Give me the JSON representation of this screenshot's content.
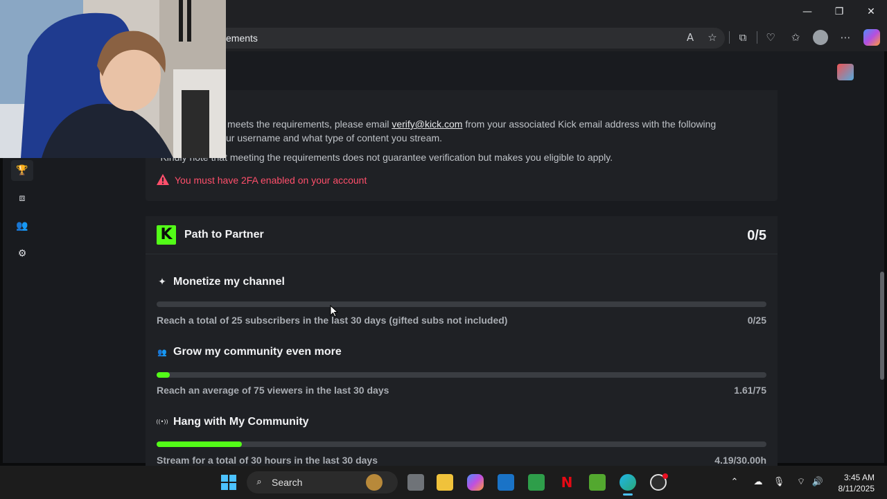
{
  "browser": {
    "address_text": "ements",
    "window_controls": {
      "minimize": "—",
      "restore": "❐",
      "close": "✕"
    },
    "toolbar_icons": [
      "read-aloud-icon",
      "favorite-star-icon",
      "extensions-icon",
      "browser-essentials-icon",
      "favorites-icon",
      "profile-avatar-icon",
      "more-icon",
      "copilot-icon"
    ]
  },
  "sidebar": {
    "items": [
      {
        "name": "trophy-icon",
        "glyph": "🏆"
      },
      {
        "name": "screen-capture-icon",
        "glyph": "⧈"
      },
      {
        "name": "community-icon",
        "glyph": "👥"
      },
      {
        "name": "settings-icon",
        "glyph": "⚙"
      }
    ]
  },
  "verification": {
    "line1_pre": "meets the requirements, please email ",
    "line1_link": "verify@kick.com",
    "line1_post": " from your associated Kick email address with the following",
    "line2": "ur username and what type of content you stream.",
    "line3": "*Kindly note that meeting the requirements does not guarantee verification but makes you eligible to apply.",
    "warning": "You must have 2FA enabled on your account"
  },
  "partner": {
    "logo_letter": "K",
    "title": "Path to Partner",
    "score": "0/5",
    "goals": [
      {
        "icon": "sparkle-icon",
        "glyph": "✦",
        "title": "Monetize my channel",
        "desc": "Reach a total of 25 subscribers in the last 30 days (gifted subs not included)",
        "value": "0/25",
        "progress": 0
      },
      {
        "icon": "community-icon",
        "glyph": "👥",
        "title": "Grow my community even more",
        "desc": "Reach an average of 75 viewers in the last 30 days",
        "value": "1.61/75",
        "progress": 0.0215
      },
      {
        "icon": "broadcast-icon",
        "glyph": "((•))",
        "title": "Hang with My Community",
        "desc": "Stream for a total of 30 hours in the last 30 days",
        "value": "4.19/30.00h",
        "progress": 0.1397
      }
    ]
  },
  "taskbar": {
    "search_label": "Search",
    "time": "3:45 AM",
    "date": "8/11/2025"
  },
  "colors": {
    "accent_green": "#53fc18",
    "warning_red": "#ff4f6b",
    "card_bg": "#1f2125",
    "page_bg": "#191b1f"
  }
}
